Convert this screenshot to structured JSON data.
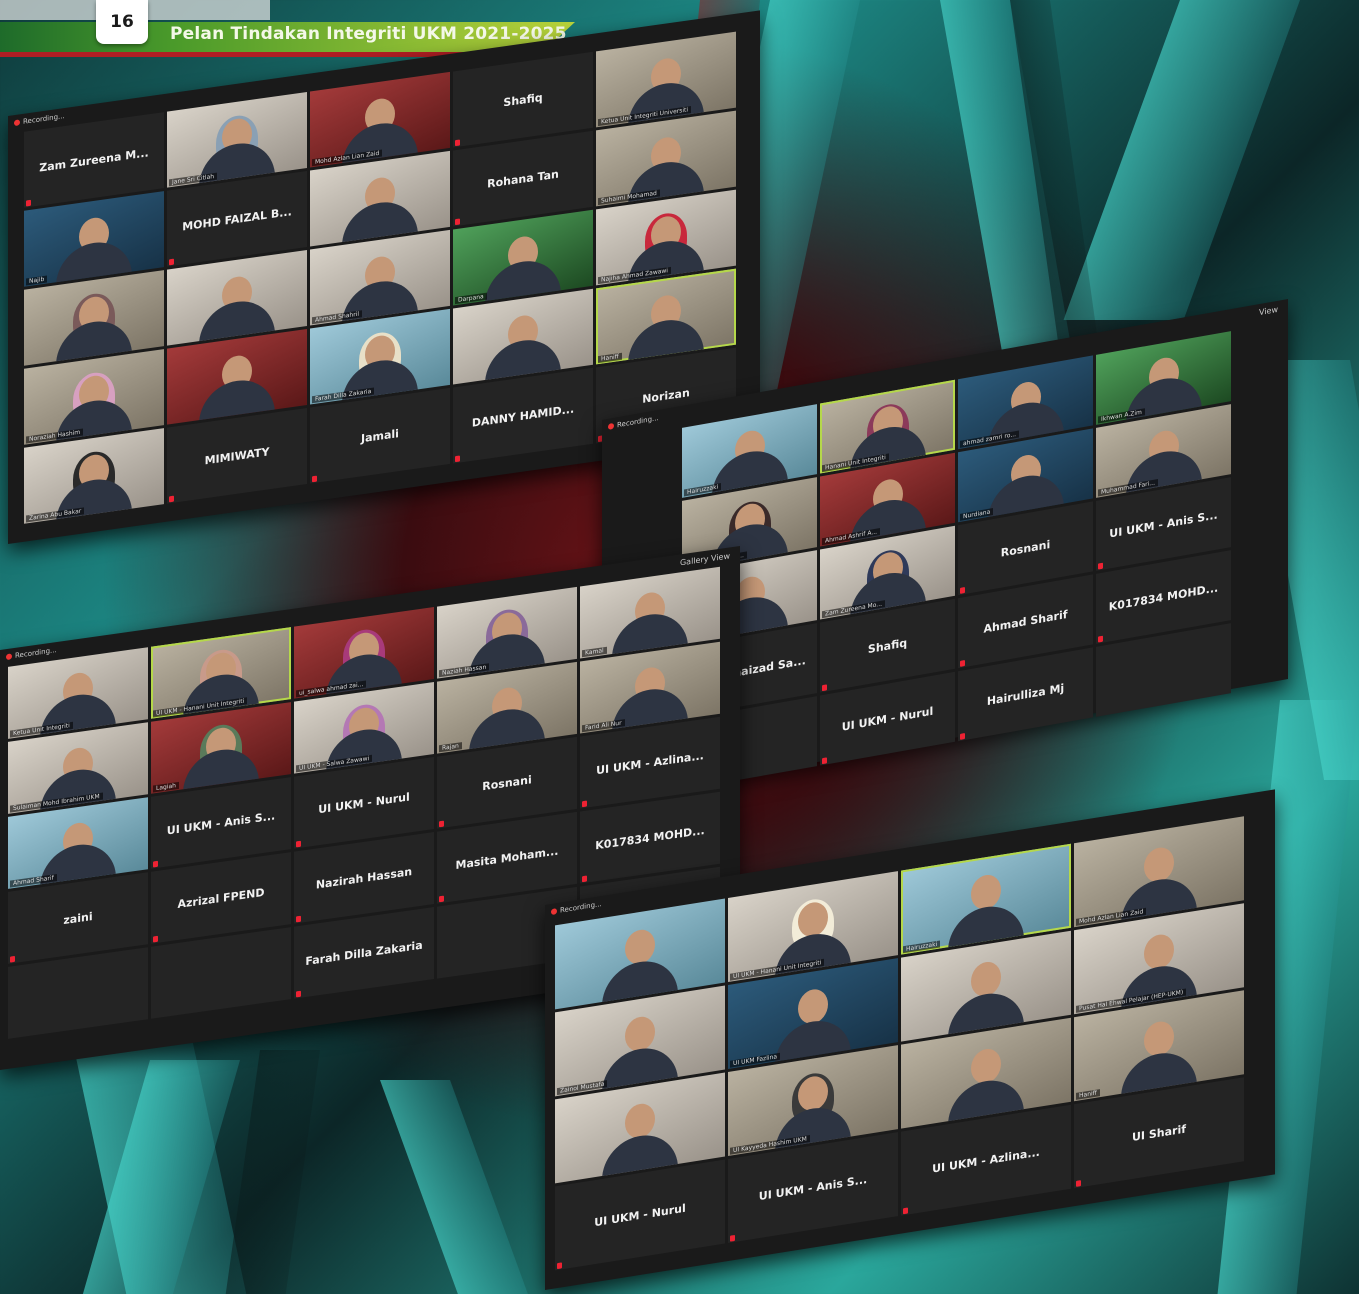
{
  "page": {
    "page_number": "16",
    "title": "Pelan Tindakan Integriti UKM 2021-2025",
    "accent_green": "#b8d23a",
    "accent_red": "#b01e24"
  },
  "windows": [
    {
      "recording": "Recording...",
      "tiles": [
        {
          "type": "name",
          "name": "Zam Zureena M..."
        },
        {
          "type": "cam",
          "label": "Jane Sri Citlah",
          "hijab": "#8aa0b4",
          "style": "c2"
        },
        {
          "type": "cam",
          "label": "Mohd Azlan Lian Zaid",
          "style": "c5"
        },
        {
          "type": "name",
          "name": "Shafiq"
        },
        {
          "type": "cam",
          "label": "Ketua Unit Integriti Universiti",
          "style": "c1"
        },
        {
          "type": "cam",
          "label": "Najib",
          "style": "c3"
        },
        {
          "type": "name",
          "name": "MOHD FAIZAL B..."
        },
        {
          "type": "cam",
          "label": "",
          "style": "c2"
        },
        {
          "type": "name",
          "name": "Rohana Tan"
        },
        {
          "type": "cam",
          "label": "Suhaimi Mohamad",
          "style": "c1"
        },
        {
          "type": "cam",
          "label": "",
          "hijab": "#7a5a5a",
          "style": "c1"
        },
        {
          "type": "cam",
          "label": "",
          "style": "c2"
        },
        {
          "type": "cam",
          "label": "Ahmad Shahril",
          "style": "c2"
        },
        {
          "type": "cam",
          "label": "Darpana",
          "style": "c4"
        },
        {
          "type": "cam",
          "label": "Najiha Ahmad Zawawi",
          "hijab": "#c8283c",
          "style": "c2"
        },
        {
          "type": "cam",
          "label": "Noraziah Hashim",
          "hijab": "#d7a0c0",
          "style": "c1"
        },
        {
          "type": "cam",
          "label": "",
          "style": "c5"
        },
        {
          "type": "cam",
          "label": "Farah Dilla Zakaria",
          "hijab": "#e8e0c8",
          "style": "c6"
        },
        {
          "type": "cam",
          "label": "",
          "style": "c2"
        },
        {
          "type": "cam",
          "label": "Haniff",
          "style": "c1",
          "active": true
        },
        {
          "type": "cam",
          "label": "Zarina Abu Bakar",
          "hijab": "#2a2a2a",
          "style": "c2"
        },
        {
          "type": "name",
          "name": "MIMIWATY"
        },
        {
          "type": "name",
          "name": "Jamali"
        },
        {
          "type": "name",
          "name": "DANNY HAMID..."
        },
        {
          "type": "name",
          "name": "Norizan"
        }
      ]
    },
    {
      "recording": "Recording...",
      "view": "View",
      "tiles": [
        {
          "type": "cam",
          "label": "Hairuzzaki",
          "style": "c6"
        },
        {
          "type": "cam",
          "label": "Hanani Unit Integriti",
          "hijab": "#8c3a5a",
          "style": "c1",
          "active": true
        },
        {
          "type": "cam",
          "label": "ahmad zamri ro...",
          "style": "c3"
        },
        {
          "type": "cam",
          "label": "Ikhwan  A.Zim",
          "style": "c4"
        },
        {
          "type": "cam",
          "label": "NURUL HAFIZAH ...",
          "hijab": "#3a2a2a",
          "style": "c1"
        },
        {
          "type": "cam",
          "label": "Ahmad Ashrif A...",
          "style": "c5"
        },
        {
          "type": "cam",
          "label": "Nurdiana",
          "style": "c3"
        },
        {
          "type": "cam",
          "label": "Muhammad Fari...",
          "style": "c1"
        },
        {
          "type": "cam",
          "label": "Rajan",
          "style": "c2"
        },
        {
          "type": "cam",
          "label": "Zam Zureena Mo...",
          "hijab": "#2f3a5a",
          "style": "c2"
        },
        {
          "type": "name",
          "name": "Rosnani"
        },
        {
          "type": "name",
          "name": "UI UKM - Anis S..."
        },
        {
          "type": "name",
          "name": "Samruhaizad  Sa..."
        },
        {
          "type": "name",
          "name": "Shafiq"
        },
        {
          "type": "name",
          "name": "Ahmad Sharif"
        },
        {
          "type": "name",
          "name": "K017834  MOHD..."
        },
        {
          "type": "name",
          "name": ""
        },
        {
          "type": "name",
          "name": "UI UKM - Nurul"
        },
        {
          "type": "name",
          "name": "Hairulliza Mj"
        },
        {
          "type": "name",
          "name": ""
        }
      ]
    },
    {
      "recording": "Recording...",
      "view": "Gallery View",
      "tiles": [
        {
          "type": "cam",
          "label": "Ketua Unit Integriti",
          "style": "c2"
        },
        {
          "type": "cam",
          "label": "UI UKM - Hanani Unit Integriti",
          "hijab": "#c89a8a",
          "style": "c1",
          "active": true
        },
        {
          "type": "cam",
          "label": "ui_salwa ahmad zai...",
          "hijab": "#a83a7a",
          "style": "c5"
        },
        {
          "type": "cam",
          "label": "Naziah Hassan",
          "hijab": "#8a6a9a",
          "style": "c2"
        },
        {
          "type": "cam",
          "label": "Kamal",
          "style": "c2"
        },
        {
          "type": "cam",
          "label": "Sulaiman Mohd Ibrahim UKM",
          "style": "c2"
        },
        {
          "type": "cam",
          "label": "Lagiah",
          "hijab": "#5a7a5a",
          "style": "c5"
        },
        {
          "type": "cam",
          "label": "UI UKM - Salwa Zawawi",
          "hijab": "#b478b4",
          "style": "c2"
        },
        {
          "type": "cam",
          "label": "Rajan",
          "style": "c1"
        },
        {
          "type": "cam",
          "label": "Farid Ali Nur",
          "style": "c1"
        },
        {
          "type": "cam",
          "label": "Ahmad Sharif",
          "style": "c6"
        },
        {
          "type": "name",
          "name": "UI UKM - Anis S..."
        },
        {
          "type": "name",
          "name": "UI UKM - Nurul"
        },
        {
          "type": "name",
          "name": "Rosnani"
        },
        {
          "type": "name",
          "name": "UI UKM - Azlina..."
        },
        {
          "type": "name",
          "name": "zaini"
        },
        {
          "type": "name",
          "name": "Azrizal FPEND"
        },
        {
          "type": "name",
          "name": "Nazirah Hassan"
        },
        {
          "type": "name",
          "name": "Masita Moham..."
        },
        {
          "type": "name",
          "name": "K017834  MOHD..."
        },
        {
          "type": "name",
          "name": ""
        },
        {
          "type": "name",
          "name": ""
        },
        {
          "type": "name",
          "name": "Farah Dilla Zakaria"
        },
        {
          "type": "name",
          "name": ""
        },
        {
          "type": "name",
          "name": ""
        }
      ]
    },
    {
      "recording": "Recording...",
      "tiles": [
        {
          "type": "cam",
          "label": "",
          "style": "c6"
        },
        {
          "type": "cam",
          "label": "UI UKM - Hanani Unit Integriti",
          "hijab": "#f2ecd8",
          "style": "c2"
        },
        {
          "type": "cam",
          "label": "Hairuzzaki",
          "style": "c6",
          "active": true
        },
        {
          "type": "cam",
          "label": "Mohd Azlan Lian Zaid",
          "style": "c1"
        },
        {
          "type": "cam",
          "label": "Zainol Mustafa",
          "style": "c2"
        },
        {
          "type": "cam",
          "label": "UI UKM Fazlina",
          "style": "c3"
        },
        {
          "type": "cam",
          "label": "",
          "style": "c2"
        },
        {
          "type": "cam",
          "label": "Pusat Hal Ehwal Pelajar (HEP-UKM)",
          "style": "c2"
        },
        {
          "type": "cam",
          "label": "",
          "style": "c2"
        },
        {
          "type": "cam",
          "label": "UI Kayyeda Hashim UKM",
          "hijab": "#3a3a3a",
          "style": "c1"
        },
        {
          "type": "cam",
          "label": "",
          "style": "c1"
        },
        {
          "type": "cam",
          "label": "Haniff",
          "style": "c1"
        },
        {
          "type": "name",
          "name": "UI UKM - Nurul"
        },
        {
          "type": "name",
          "name": "UI UKM - Anis S..."
        },
        {
          "type": "name",
          "name": "UI UKM - Azlina..."
        },
        {
          "type": "name",
          "name": "UI Sharif"
        }
      ]
    }
  ]
}
